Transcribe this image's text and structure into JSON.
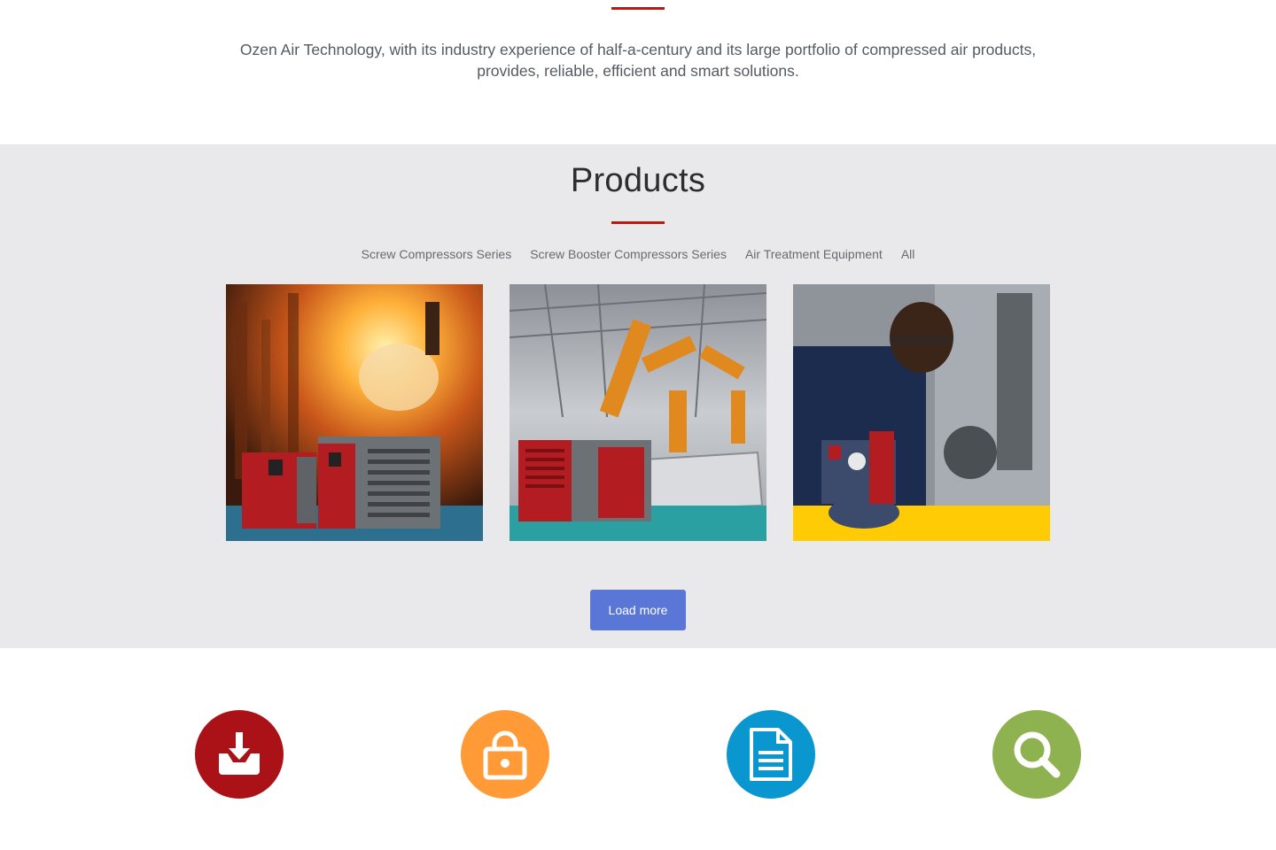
{
  "intro": {
    "text": "Ozen Air Technology, with its industry experience of half-a-century and its large portfolio of compressed air products, provides, reliable, efficient and smart solutions."
  },
  "products": {
    "title": "Products",
    "filters": [
      "Screw Compressors Series",
      "Screw Booster Compressors Series",
      "Air Treatment Equipment",
      "All"
    ],
    "cards": [
      {
        "image": "steel-foundry-compressors",
        "band_color": "#2c6f8e"
      },
      {
        "image": "robotic-assembly-line-compressor",
        "band_color": "#2aa0a3"
      },
      {
        "image": "workshop-engineer-compressor",
        "band_color": "#ffcb05"
      }
    ],
    "load_more_label": "Load more"
  },
  "features": [
    {
      "icon": "download-tray-icon",
      "color": "#ab1217"
    },
    {
      "icon": "lock-icon",
      "color": "#ff9a37"
    },
    {
      "icon": "document-icon",
      "color": "#0a97cf"
    },
    {
      "icon": "search-icon",
      "color": "#8fb250"
    }
  ],
  "colors": {
    "accent_rule": "#b71c14",
    "button": "#5a76d6",
    "band_bg": "#e9e9eb"
  }
}
